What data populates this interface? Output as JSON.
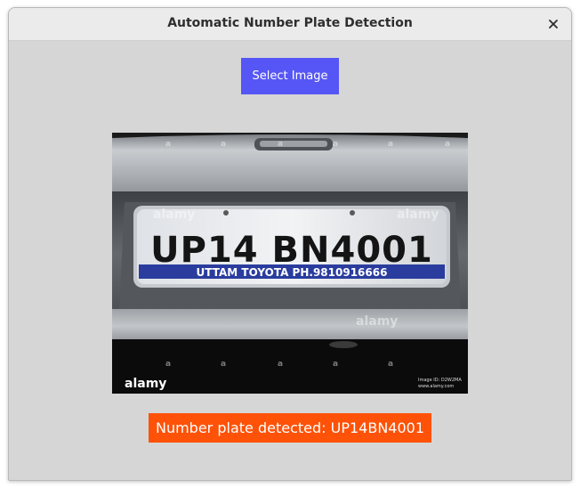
{
  "window": {
    "title": "Automatic Number Plate Detection"
  },
  "icons": {
    "close": "close-icon"
  },
  "toolbar": {
    "select_image_label": "Select Image"
  },
  "image": {
    "plate_text": "UP14 BN4001",
    "dealer_text": "UTTAM TOYOTA PH.9810916666",
    "watermark": "alamy",
    "watermark_small": "a",
    "image_id": "Image ID: D2W2MA",
    "site": "www.alamy.com"
  },
  "result": {
    "text": "Number plate detected: UP14BN4001"
  },
  "colors": {
    "button_bg": "#5656f6",
    "result_bg": "#fe5208",
    "window_bg": "#d6d6d6",
    "titlebar_bg": "#ebebeb"
  }
}
